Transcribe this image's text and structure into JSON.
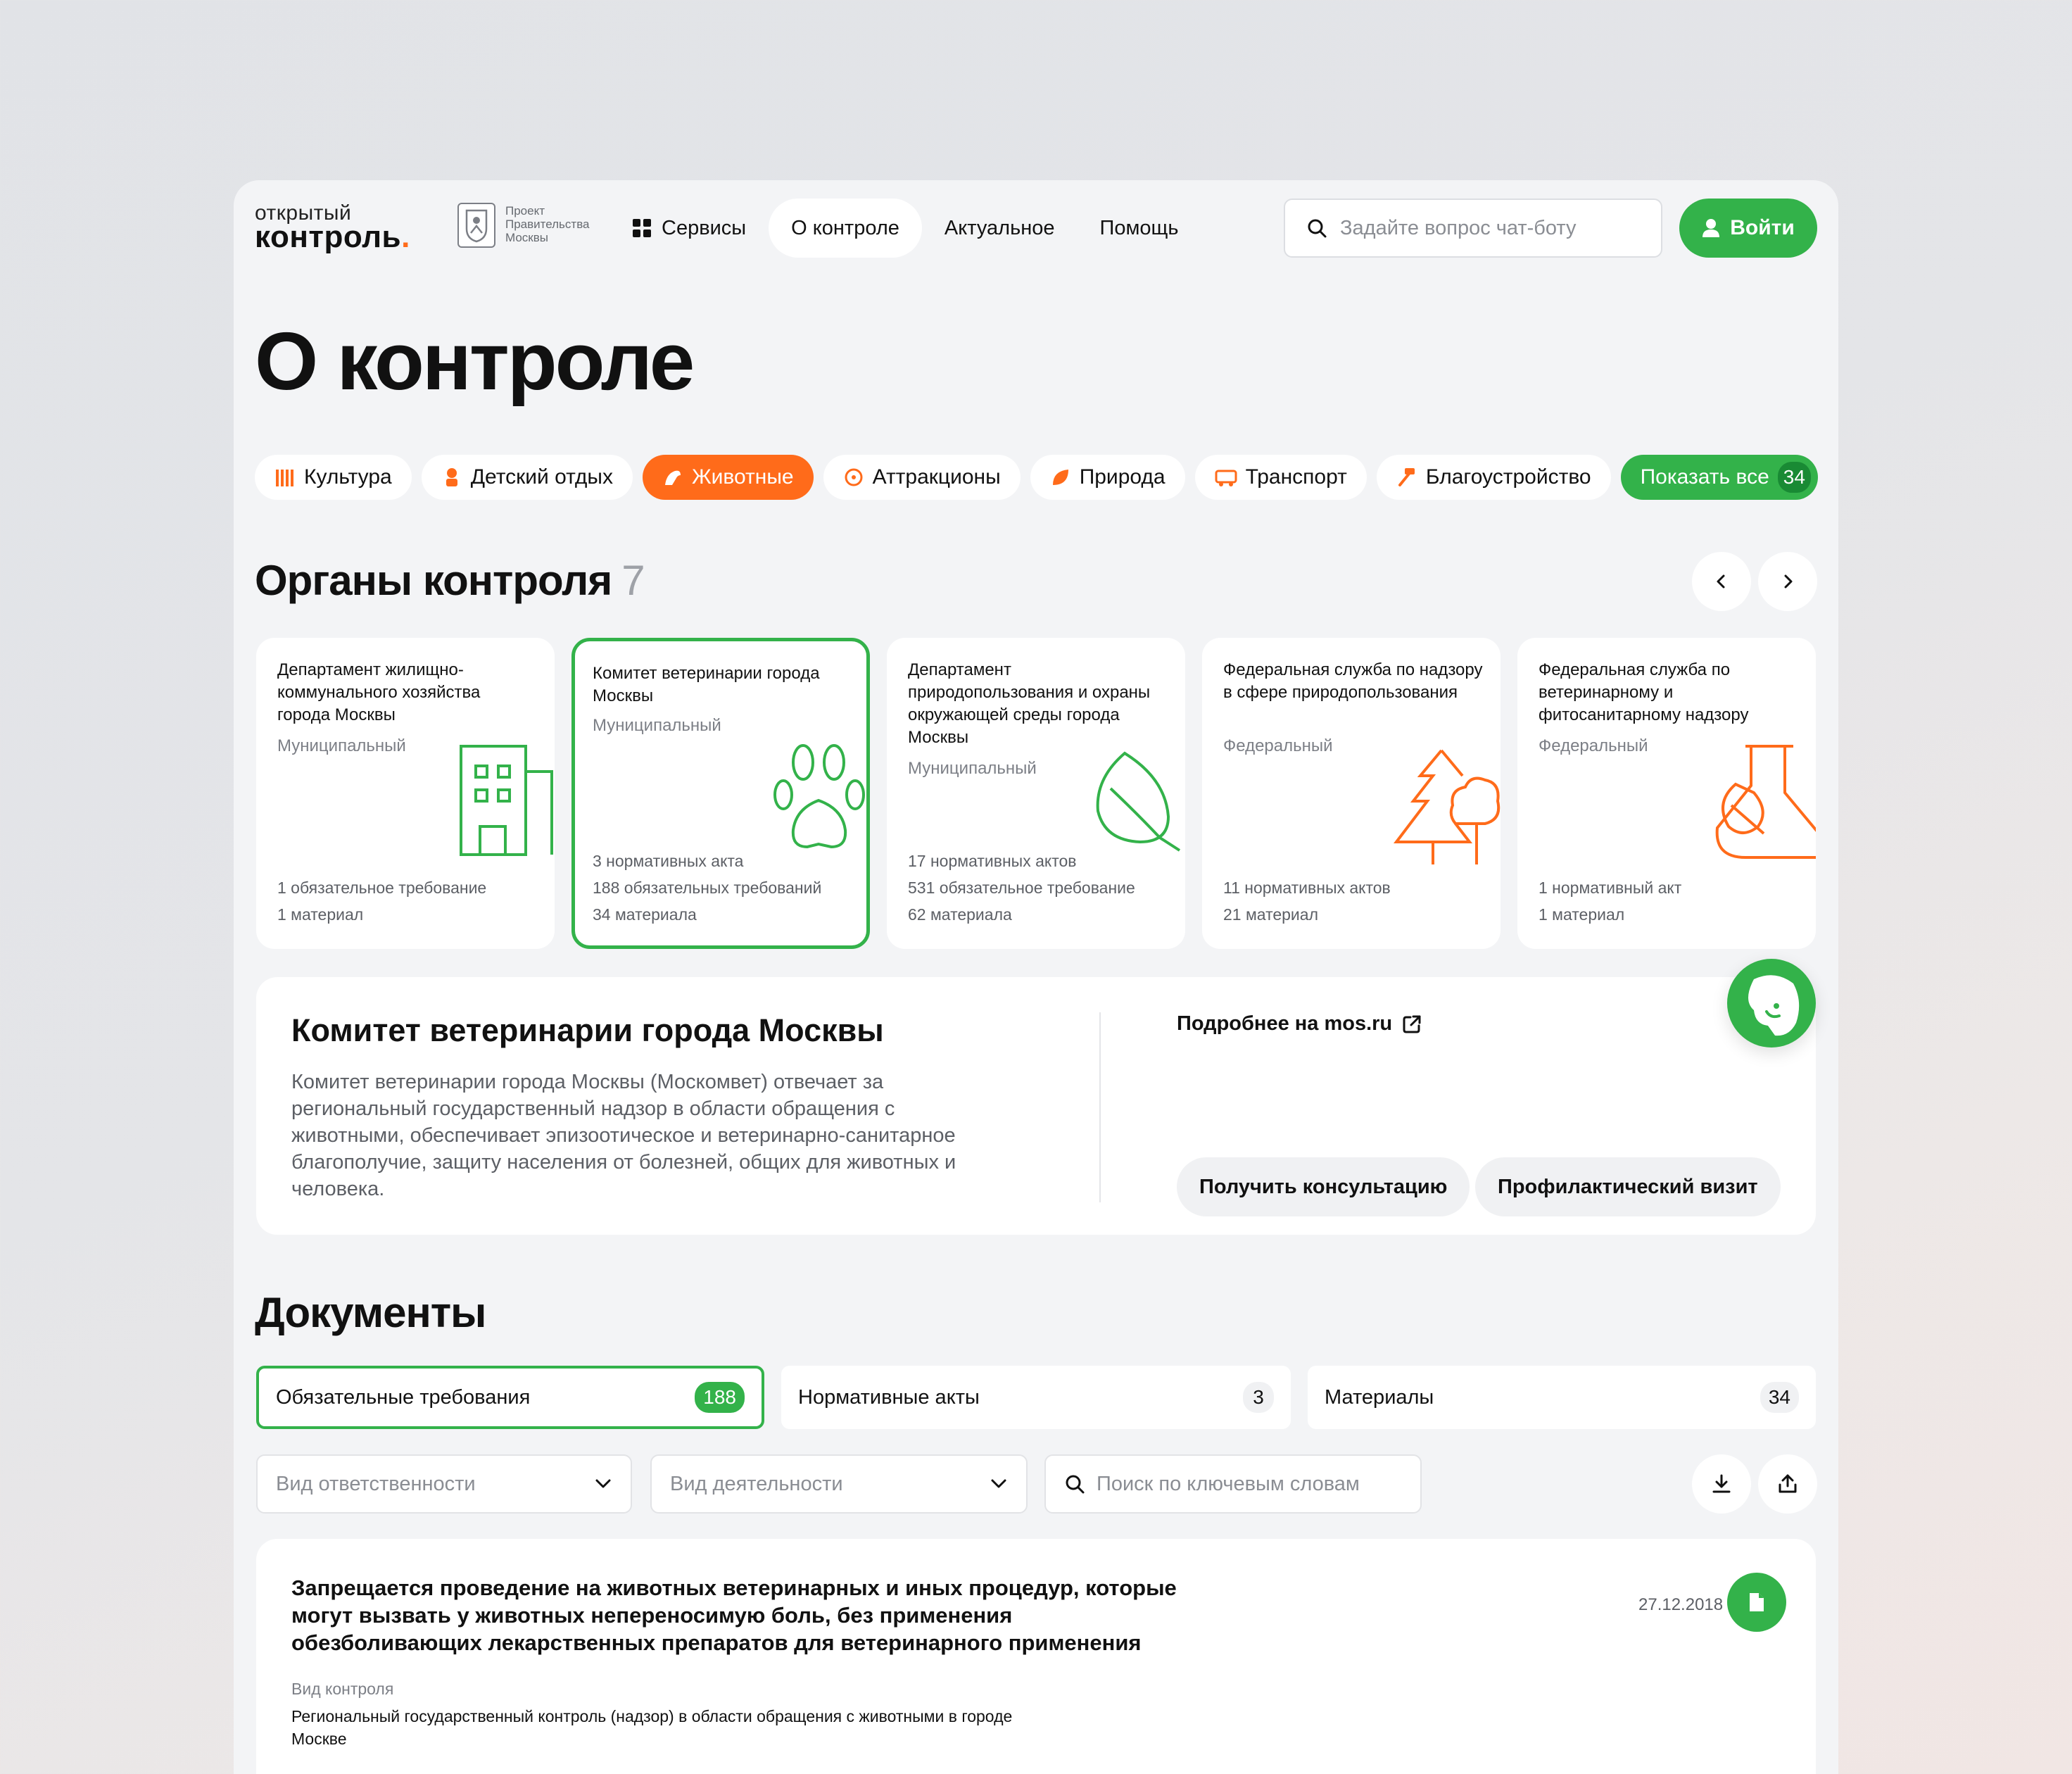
{
  "header": {
    "logo_top": "открытый",
    "logo_main": "контроль",
    "logo_dot": ".",
    "gov_caption": "Проект Правительства Москвы",
    "nav": [
      {
        "label": "Сервисы",
        "active": false
      },
      {
        "label": "О контроле",
        "active": true
      },
      {
        "label": "Актуальное",
        "active": false
      },
      {
        "label": "Помощь",
        "active": false
      }
    ],
    "search_placeholder": "Задайте вопрос чат-боту",
    "login_label": "Войти"
  },
  "page_title": "О контроле",
  "categories": [
    {
      "label": "Культура",
      "icon": "theater-icon"
    },
    {
      "label": "Детский отдых",
      "icon": "child-icon"
    },
    {
      "label": "Животные",
      "icon": "animal-icon",
      "active": true
    },
    {
      "label": "Аттракционы",
      "icon": "ferris-wheel-icon"
    },
    {
      "label": "Природа",
      "icon": "leaf-icon"
    },
    {
      "label": "Транспорт",
      "icon": "bus-icon"
    },
    {
      "label": "Благоустройство",
      "icon": "hammer-icon"
    }
  ],
  "show_all": {
    "label": "Показать все",
    "count": "34"
  },
  "authorities": {
    "title": "Органы контроля",
    "count": "7",
    "cards": [
      {
        "name": "Департамент жилищно-коммунального хозяйства города Москвы",
        "type": "Муниципальный",
        "stats": [
          "1 обязательное требование",
          "1 материал"
        ],
        "icon": "building-icon"
      },
      {
        "name": "Комитет ветеринарии города Москвы",
        "type": "Муниципальный",
        "stats": [
          "3 нормативных акта",
          "188 обязательных требований",
          "34 материала"
        ],
        "icon": "paw-icon",
        "selected": true
      },
      {
        "name": "Департамент природопользования и охраны окружающей среды города Москвы",
        "type": "Муниципальный",
        "stats": [
          "17 нормативных актов",
          "531 обязательное требование",
          "62 материала"
        ],
        "icon": "leaf-icon"
      },
      {
        "name": "Федеральная служба по надзору в сфере природопользования",
        "type": "Федеральный",
        "stats": [
          "11 нормативных актов",
          "21 материал"
        ],
        "icon": "trees-icon"
      },
      {
        "name": "Федеральная служба по ветеринарному и фитосанитарному надзору",
        "type": "Федеральный",
        "stats": [
          "1 нормативный акт",
          "1 материал"
        ],
        "icon": "flask-leaf-icon"
      }
    ]
  },
  "detail": {
    "title": "Комитет ветеринарии города Москвы",
    "description": "Комитет ветеринарии города Москвы (Москомвет) отвечает за региональный государственный надзор в области обращения с животными, обеспечивает эпизоотическое и ветеринарно-санитарное благополучие, защиту населения от болезней, общих для животных и человека.",
    "more_link": "Подробнее на mos.ru",
    "btn_consult": "Получить консультацию",
    "btn_visit": "Профилактический визит"
  },
  "documents": {
    "title": "Документы",
    "tabs": [
      {
        "label": "Обязательные требования",
        "count": "188",
        "selected": true
      },
      {
        "label": "Нормативные акты",
        "count": "3"
      },
      {
        "label": "Материалы",
        "count": "34"
      }
    ],
    "filter_responsibility": "Вид ответственности",
    "filter_activity": "Вид деятельности",
    "keyword_placeholder": "Поиск по ключевым словам",
    "items": [
      {
        "title": "Запрещается проведение на животных ветеринарных и иных процедур, которые могут вызвать у животных непереносимую боль, без применения обезболивающих лекарственных препаратов для ветеринарного применения",
        "date": "27.12.2018",
        "meta_label": "Вид контроля",
        "meta_value": "Региональный государственный контроль (надзор) в области обращения с животными в городе Москве"
      }
    ]
  },
  "colors": {
    "green": "#33b24a",
    "orange": "#ff6b1a",
    "background": "#f3f4f6"
  }
}
